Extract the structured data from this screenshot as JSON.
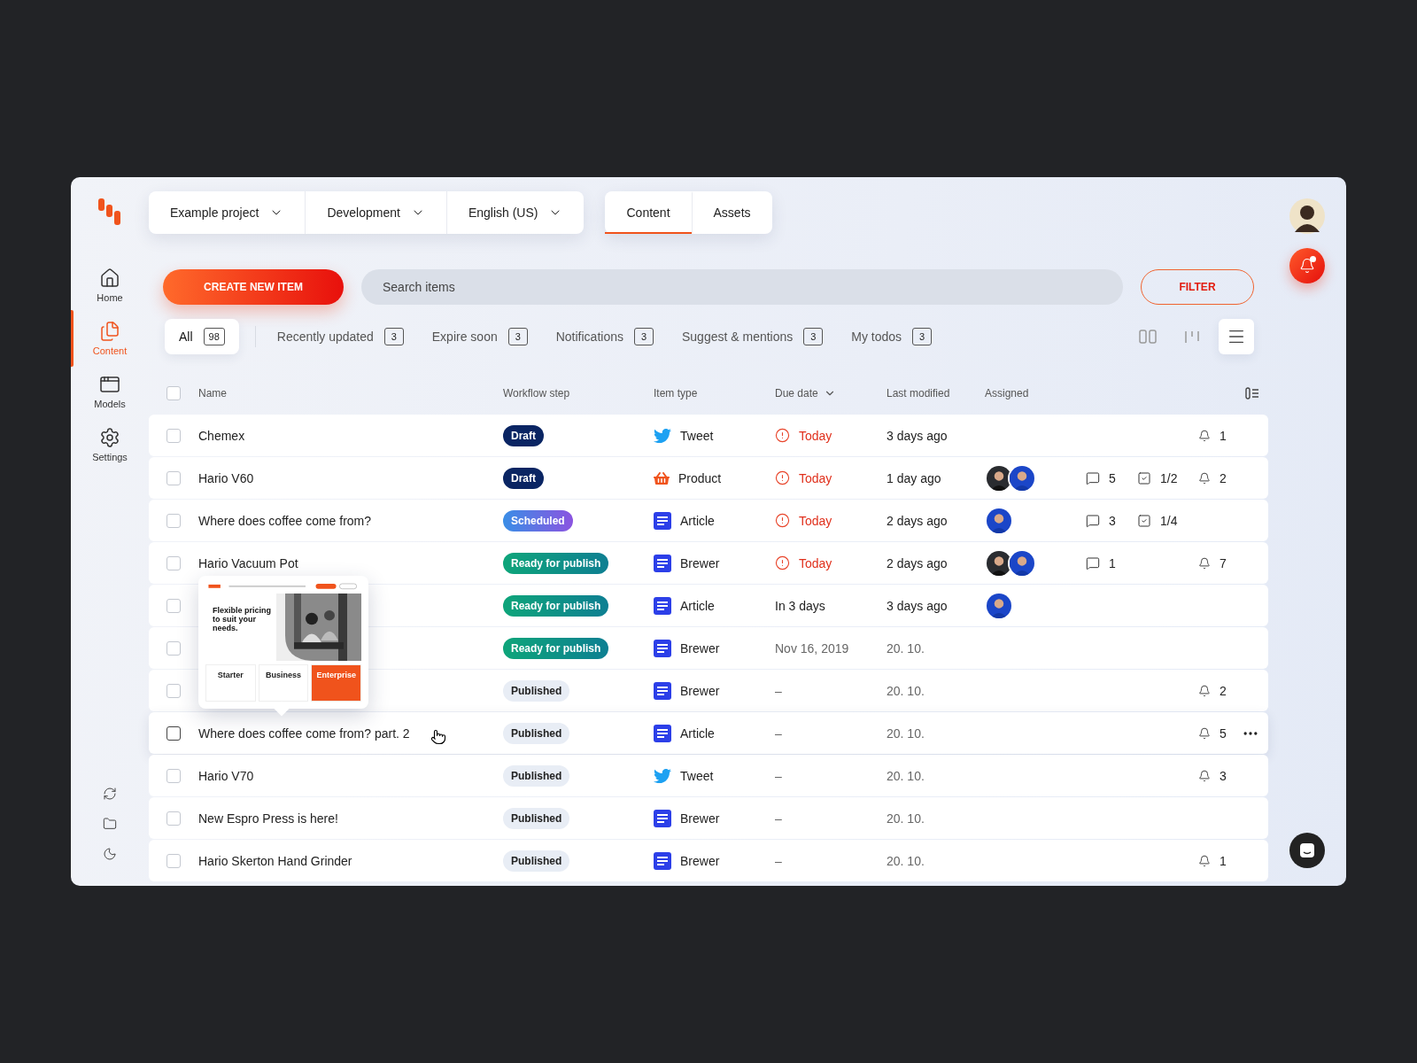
{
  "sidebar": {
    "nav": [
      {
        "label": "Home",
        "kind": "home",
        "selected": false
      },
      {
        "label": "Content",
        "kind": "content",
        "selected": true
      },
      {
        "label": "Models",
        "kind": "models",
        "selected": false
      },
      {
        "label": "Settings",
        "kind": "settings",
        "selected": false
      }
    ]
  },
  "project_selectors": [
    {
      "label": "Example project"
    },
    {
      "label": "Development"
    },
    {
      "label": "English (US)"
    }
  ],
  "section_tabs": [
    {
      "label": "Content",
      "selected": true
    },
    {
      "label": "Assets",
      "selected": false
    }
  ],
  "create_button": "CREATE NEW ITEM",
  "search": {
    "placeholder": "Search items"
  },
  "filter_button": "FILTER",
  "user": {
    "unread_notifications": true
  },
  "quick_filters": [
    {
      "label": "All",
      "count": "98",
      "selected": true
    },
    {
      "label": "Recently updated",
      "count": "3",
      "selected": false
    },
    {
      "label": "Expire soon",
      "count": "3",
      "selected": false
    },
    {
      "label": "Notifications",
      "count": "3",
      "selected": false
    },
    {
      "label": "Suggest & mentions",
      "count": "3",
      "selected": false
    },
    {
      "label": "My todos",
      "count": "3",
      "selected": false
    }
  ],
  "view_modes": [
    {
      "kind": "board",
      "selected": false
    },
    {
      "kind": "timeline",
      "selected": false
    },
    {
      "kind": "list",
      "selected": true
    }
  ],
  "table": {
    "all_checked": false,
    "columns": [
      {
        "label": "Name",
        "sorted": false
      },
      {
        "label": "Workflow step",
        "sorted": false
      },
      {
        "label": "Item type",
        "sorted": false
      },
      {
        "label": "Due date",
        "sorted": true
      },
      {
        "label": "Last modified",
        "sorted": false
      },
      {
        "label": "Assigned",
        "sorted": false
      }
    ],
    "rows": [
      {
        "name": "Chemex",
        "checked": false,
        "hovered": false,
        "status": {
          "label": "Draft",
          "kind": "draft"
        },
        "type": {
          "label": "Tweet",
          "kind": "tweet"
        },
        "due": {
          "text": "Today",
          "kind": "overdue"
        },
        "modified": {
          "text": "3 days ago",
          "muted": false
        },
        "assignees": [],
        "notifications": "1"
      },
      {
        "name": "Hario V60",
        "checked": false,
        "hovered": false,
        "status": {
          "label": "Draft",
          "kind": "draft"
        },
        "type": {
          "label": "Product",
          "kind": "product"
        },
        "due": {
          "text": "Today",
          "kind": "overdue"
        },
        "modified": {
          "text": "1 day ago",
          "muted": false
        },
        "assignees": [
          {
            "kind": "dark"
          },
          {
            "kind": "blue"
          }
        ],
        "comments": "5",
        "tasks": "1/2",
        "notifications": "2"
      },
      {
        "name": "Where does coffee come from?",
        "checked": false,
        "hovered": false,
        "status": {
          "label": "Scheduled",
          "kind": "scheduled"
        },
        "type": {
          "label": "Article",
          "kind": "article"
        },
        "due": {
          "text": "Today",
          "kind": "overdue"
        },
        "modified": {
          "text": "2 days ago",
          "muted": false
        },
        "assignees": [
          {
            "kind": "blue"
          }
        ],
        "comments": "3",
        "tasks": "1/4"
      },
      {
        "name": "Hario Vacuum Pot",
        "checked": false,
        "hovered": false,
        "status": {
          "label": "Ready for publish",
          "kind": "ready"
        },
        "type": {
          "label": "Brewer",
          "kind": "article"
        },
        "due": {
          "text": "Today",
          "kind": "overdue"
        },
        "modified": {
          "text": "2 days ago",
          "muted": false
        },
        "assignees": [
          {
            "kind": "dark"
          },
          {
            "kind": "blue"
          }
        ],
        "comments": "1",
        "notifications": "7"
      },
      {
        "checked": false,
        "hovered": false,
        "status": {
          "label": "Ready for publish",
          "kind": "ready"
        },
        "type": {
          "label": "Article",
          "kind": "article"
        },
        "due": {
          "text": "In 3 days",
          "kind": "normal"
        },
        "modified": {
          "text": "3 days ago",
          "muted": false
        },
        "assignees": [
          {
            "kind": "blue"
          }
        ]
      },
      {
        "checked": false,
        "hovered": false,
        "status": {
          "label": "Ready for publish",
          "kind": "ready"
        },
        "type": {
          "label": "Brewer",
          "kind": "article"
        },
        "due": {
          "text": "Nov 16, 2019",
          "kind": "muted"
        },
        "modified": {
          "text": "20. 10.",
          "muted": true
        },
        "assignees": []
      },
      {
        "checked": false,
        "hovered": false,
        "status": {
          "label": "Published",
          "kind": "published"
        },
        "type": {
          "label": "Brewer",
          "kind": "article"
        },
        "due": {
          "text": "–",
          "kind": "muted"
        },
        "modified": {
          "text": "20. 10.",
          "muted": true
        },
        "assignees": [],
        "notifications": "2"
      },
      {
        "name": "Where does coffee come from? part. 2",
        "checked": false,
        "hovered": true,
        "status": {
          "label": "Published",
          "kind": "published"
        },
        "type": {
          "label": "Article",
          "kind": "article"
        },
        "due": {
          "text": "–",
          "kind": "muted"
        },
        "modified": {
          "text": "20. 10.",
          "muted": true
        },
        "assignees": [],
        "notifications": "5"
      },
      {
        "name": "Hario V70",
        "checked": false,
        "hovered": false,
        "status": {
          "label": "Published",
          "kind": "published"
        },
        "type": {
          "label": "Tweet",
          "kind": "tweet"
        },
        "due": {
          "text": "–",
          "kind": "muted"
        },
        "modified": {
          "text": "20. 10.",
          "muted": true
        },
        "assignees": [],
        "notifications": "3"
      },
      {
        "name": "New Espro Press is here!",
        "checked": false,
        "hovered": false,
        "status": {
          "label": "Published",
          "kind": "published"
        },
        "type": {
          "label": "Brewer",
          "kind": "article"
        },
        "due": {
          "text": "–",
          "kind": "muted"
        },
        "modified": {
          "text": "20. 10.",
          "muted": true
        },
        "assignees": []
      },
      {
        "name": "Hario Skerton Hand Grinder",
        "checked": false,
        "hovered": false,
        "status": {
          "label": "Published",
          "kind": "published"
        },
        "type": {
          "label": "Brewer",
          "kind": "article"
        },
        "due": {
          "text": "–",
          "kind": "muted"
        },
        "modified": {
          "text": "20. 10.",
          "muted": true
        },
        "assignees": [],
        "notifications": "1"
      }
    ]
  },
  "preview": {
    "heading": "Flexible pricing to suit your needs.",
    "plans": [
      {
        "label": "Starter",
        "selected": false
      },
      {
        "label": "Business",
        "selected": false
      },
      {
        "label": "Enterprise",
        "selected": true
      }
    ]
  }
}
